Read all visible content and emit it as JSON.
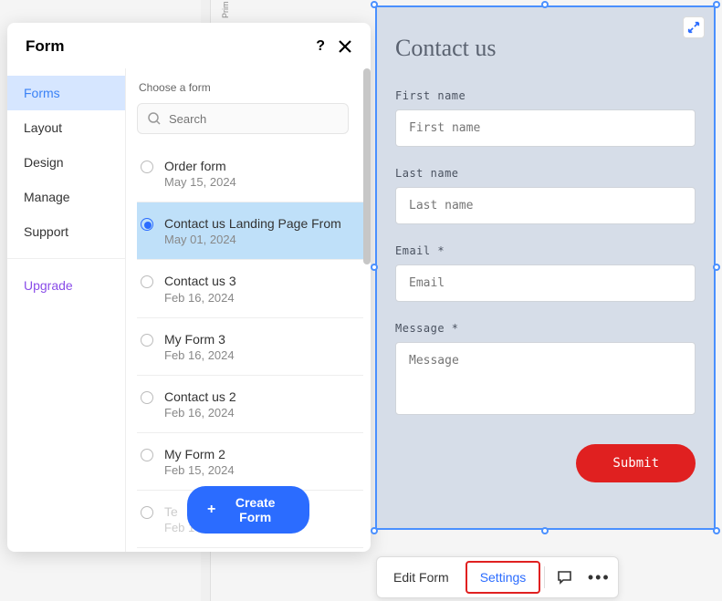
{
  "canvas_label": "Prim",
  "panel": {
    "title": "Form",
    "sidebar": {
      "items": [
        "Forms",
        "Layout",
        "Design",
        "Manage",
        "Support"
      ],
      "active_index": 0,
      "upgrade": "Upgrade"
    },
    "content": {
      "choose_label": "Choose a form",
      "search_placeholder": "Search",
      "forms": [
        {
          "name": "Order form",
          "date": "May 15, 2024",
          "selected": false
        },
        {
          "name": "Contact us Landing Page From",
          "date": "May 01, 2024",
          "selected": true
        },
        {
          "name": "Contact us 3",
          "date": "Feb 16, 2024",
          "selected": false
        },
        {
          "name": "My Form 3",
          "date": "Feb 16, 2024",
          "selected": false
        },
        {
          "name": "Contact us 2",
          "date": "Feb 16, 2024",
          "selected": false
        },
        {
          "name": "My Form 2",
          "date": "Feb 15, 2024",
          "selected": false
        },
        {
          "name": "Te",
          "date": "Feb 14, 2024",
          "selected": false,
          "cutoff": true
        }
      ],
      "create_button": "Create Form"
    }
  },
  "preview": {
    "title": "Contact us",
    "fields": {
      "first_name": {
        "label": "First name",
        "placeholder": "First name"
      },
      "last_name": {
        "label": "Last name",
        "placeholder": "Last name"
      },
      "email": {
        "label": "Email *",
        "placeholder": "Email"
      },
      "message": {
        "label": "Message *",
        "placeholder": "Message"
      }
    },
    "submit": "Submit"
  },
  "toolbar": {
    "edit": "Edit Form",
    "settings": "Settings"
  }
}
